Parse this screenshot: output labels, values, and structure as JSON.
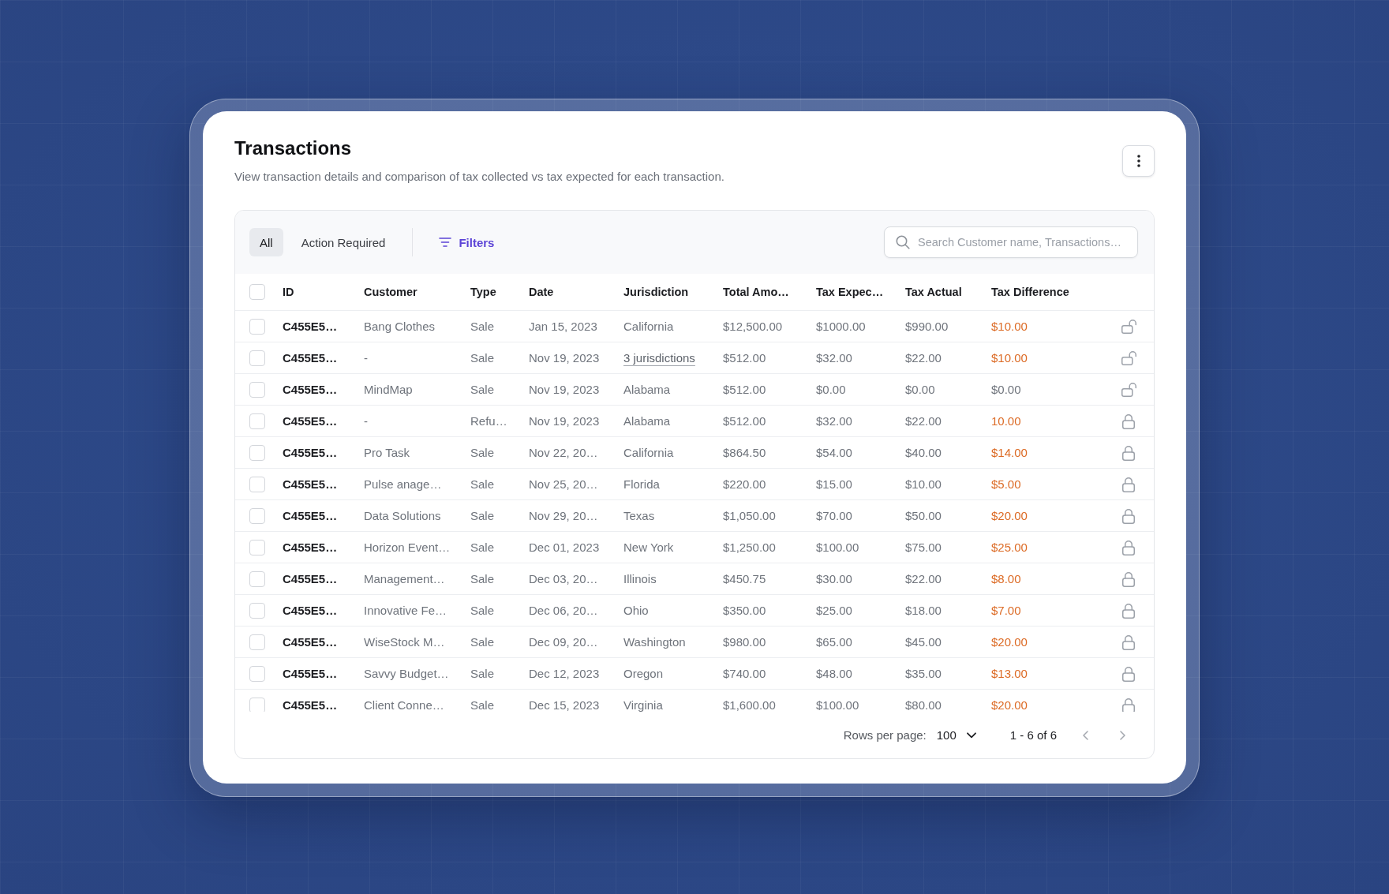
{
  "header": {
    "title": "Transactions",
    "subtitle": "View transaction details and comparison of tax collected vs tax expected for each transaction."
  },
  "toolbar": {
    "tabs": [
      {
        "label": "All",
        "selected": true
      },
      {
        "label": "Action Required",
        "selected": false
      }
    ],
    "filters_label": "Filters",
    "search": {
      "placeholder": "Search Customer name, Transactions…"
    }
  },
  "table": {
    "select_all_checked": false,
    "columns": [
      "ID",
      "Customer",
      "Type",
      "Date",
      "Jurisdiction",
      "Total Amo…",
      "Tax Expec…",
      "Tax Actual",
      "Tax Difference"
    ],
    "rows": [
      {
        "checked": false,
        "cells": [
          "C455E5…",
          "Bang Clothes",
          "Sale",
          "Jan 15, 2023",
          "California",
          "$12,500.00",
          "$1000.00",
          "$990.00",
          "$10.00"
        ],
        "jurisdiction_link": false,
        "difference_alert": true,
        "locked": false
      },
      {
        "checked": false,
        "cells": [
          "C455E5…",
          "-",
          "Sale",
          "Nov 19, 2023",
          "3 jurisdictions",
          "$512.00",
          "$32.00",
          "$22.00",
          "$10.00"
        ],
        "jurisdiction_link": true,
        "difference_alert": true,
        "locked": false
      },
      {
        "checked": false,
        "cells": [
          "C455E5…",
          "MindMap",
          "Sale",
          "Nov 19, 2023",
          "Alabama",
          "$512.00",
          "$0.00",
          "$0.00",
          "$0.00"
        ],
        "jurisdiction_link": false,
        "difference_alert": false,
        "locked": false
      },
      {
        "checked": false,
        "cells": [
          "C455E5…",
          "-",
          "Refu…",
          "Nov 19, 2023",
          "Alabama",
          "$512.00",
          "$32.00",
          "$22.00",
          "10.00"
        ],
        "jurisdiction_link": false,
        "difference_alert": true,
        "locked": true
      },
      {
        "checked": false,
        "cells": [
          "C455E5…",
          "Pro Task",
          "Sale",
          "Nov 22, 20…",
          "California",
          "$864.50",
          "$54.00",
          "$40.00",
          "$14.00"
        ],
        "jurisdiction_link": false,
        "difference_alert": true,
        "locked": true
      },
      {
        "checked": false,
        "cells": [
          "C455E5…",
          "Pulse anage…",
          "Sale",
          "Nov 25, 20…",
          "Florida",
          "$220.00",
          "$15.00",
          "$10.00",
          "$5.00"
        ],
        "jurisdiction_link": false,
        "difference_alert": true,
        "locked": true
      },
      {
        "checked": false,
        "cells": [
          "C455E5…",
          "Data Solutions",
          "Sale",
          "Nov 29, 20…",
          "Texas",
          "$1,050.00",
          "$70.00",
          "$50.00",
          "$20.00"
        ],
        "jurisdiction_link": false,
        "difference_alert": true,
        "locked": true
      },
      {
        "checked": false,
        "cells": [
          "C455E5…",
          "Horizon Event…",
          "Sale",
          "Dec 01, 2023",
          "New York",
          "$1,250.00",
          "$100.00",
          "$75.00",
          "$25.00"
        ],
        "jurisdiction_link": false,
        "difference_alert": true,
        "locked": true
      },
      {
        "checked": false,
        "cells": [
          "C455E5…",
          "Management…",
          "Sale",
          "Dec 03, 20…",
          "Illinois",
          "$450.75",
          "$30.00",
          "$22.00",
          "$8.00"
        ],
        "jurisdiction_link": false,
        "difference_alert": true,
        "locked": true
      },
      {
        "checked": false,
        "cells": [
          "C455E5…",
          "Innovative Fe…",
          "Sale",
          "Dec 06, 20…",
          "Ohio",
          "$350.00",
          "$25.00",
          "$18.00",
          "$7.00"
        ],
        "jurisdiction_link": false,
        "difference_alert": true,
        "locked": true
      },
      {
        "checked": false,
        "cells": [
          "C455E5…",
          "WiseStock M…",
          "Sale",
          "Dec 09, 20…",
          "Washington",
          "$980.00",
          "$65.00",
          "$45.00",
          "$20.00"
        ],
        "jurisdiction_link": false,
        "difference_alert": true,
        "locked": true
      },
      {
        "checked": false,
        "cells": [
          "C455E5…",
          "Savvy Budget…",
          "Sale",
          "Dec 12, 2023",
          "Oregon",
          "$740.00",
          "$48.00",
          "$35.00",
          "$13.00"
        ],
        "jurisdiction_link": false,
        "difference_alert": true,
        "locked": true
      },
      {
        "checked": false,
        "cells": [
          "C455E5…",
          "Client Conne…",
          "Sale",
          "Dec 15, 2023",
          "Virginia",
          "$1,600.00",
          "$100.00",
          "$80.00",
          "$20.00"
        ],
        "jurisdiction_link": false,
        "difference_alert": true,
        "locked": true
      }
    ]
  },
  "pagination": {
    "rows_per_page_label": "Rows per page:",
    "rows_per_page": "100",
    "range": "1 - 6 of 6"
  }
}
